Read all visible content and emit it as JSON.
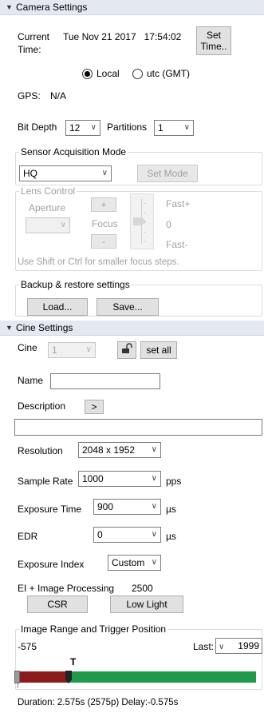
{
  "camera": {
    "header": "Camera Settings",
    "current_time_label": "Current Time:",
    "current_time_value": "Tue Nov 21 2017   17:54:02",
    "set_time_button": "Set Time..",
    "radio_local": "Local",
    "radio_utc": "utc (GMT)",
    "gps_label": "GPS:",
    "gps_value": "N/A",
    "bit_depth_label": "Bit Depth",
    "bit_depth_value": "12",
    "partitions_label": "Partitions",
    "partitions_value": "1"
  },
  "sensor": {
    "title": "Sensor Acquisition Mode",
    "mode_value": "HQ",
    "set_mode_button": "Set Mode"
  },
  "lens": {
    "title": "Lens Control",
    "aperture_label": "Aperture",
    "focus_label": "Focus",
    "plus": "+",
    "minus": "-",
    "fast_plus": "Fast+",
    "zero": "0",
    "fast_minus": "Fast-",
    "hint": "Use Shift or Ctrl for smaller focus steps."
  },
  "backup": {
    "title": "Backup & restore settings",
    "load_button": "Load...",
    "save_button": "Save..."
  },
  "cine": {
    "header": "Cine Settings",
    "cine_label": "Cine",
    "cine_value": "1",
    "set_all_button": "set all",
    "name_label": "Name",
    "name_value": "",
    "description_label": "Description",
    "description_button": ">",
    "description_value": "",
    "resolution_label": "Resolution",
    "resolution_value": "2048 x 1952",
    "sample_rate_label": "Sample Rate",
    "sample_rate_value": "1000",
    "sample_rate_unit": "pps",
    "exposure_time_label": "Exposure Time",
    "exposure_time_value": "900",
    "exposure_time_unit": "µs",
    "edr_label": "EDR",
    "edr_value": "0",
    "edr_unit": "µs",
    "exposure_index_label": "Exposure Index",
    "exposure_index_value": "Custom",
    "ei_processing_label": "EI + Image Processing",
    "ei_processing_value": "2500",
    "csr_button": "CSR",
    "low_light_button": "Low Light"
  },
  "range": {
    "title": "Image Range and Trigger Position",
    "first_value": "-575",
    "last_label": "Last:",
    "last_value": "1999",
    "trigger_marker": "T",
    "start_marker": "I",
    "pre_trigger_fraction": 0.2233,
    "pre_color": "#8b1a1a",
    "post_color": "#1f9a4a",
    "duration_text": "Duration: 2.575s (2575p) Delay:-0.575s"
  }
}
